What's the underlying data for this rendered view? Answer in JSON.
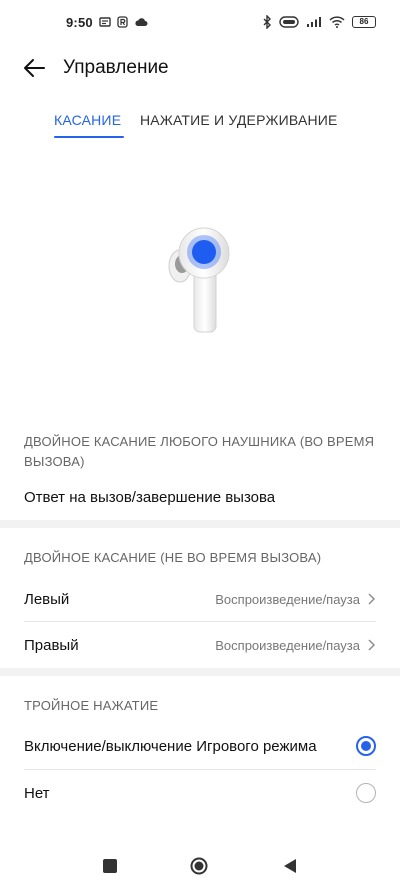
{
  "status_bar": {
    "time": "9:50",
    "battery": "86",
    "icons": [
      "message-icon",
      "r-icon",
      "cloud-icon",
      "bluetooth-icon",
      "earbuds-case-icon",
      "signal-icon",
      "wifi-icon",
      "battery-icon"
    ]
  },
  "header": {
    "title": "Управление",
    "back_icon": "arrow-left-icon"
  },
  "tabs": [
    {
      "label": "КАСАНИЕ",
      "active": true
    },
    {
      "label": "НАЖАТИЕ И УДЕРЖИВАНИЕ",
      "active": false
    }
  ],
  "sections": {
    "call": {
      "header": "ДВОЙНОЕ КАСАНИЕ ЛЮБОГО НАУШНИКА (ВО ВРЕМЯ ВЫЗОВА)",
      "value": "Ответ на вызов/завершение вызова"
    },
    "no_call": {
      "header": "ДВОЙНОЕ КАСАНИЕ (НЕ ВО ВРЕМЯ ВЫЗОВА)",
      "left_label": "Левый",
      "left_value": "Воспроизведение/пауза",
      "right_label": "Правый",
      "right_value": "Воспроизведение/пауза"
    },
    "triple": {
      "header": "ТРОЙНОЕ НАЖАТИЕ",
      "options": [
        {
          "label": "Включение/выключение Игрового режима",
          "selected": true
        },
        {
          "label": "Нет",
          "selected": false
        }
      ]
    }
  },
  "colors": {
    "accent": "#2563eb",
    "separator_band": "#f2f2f2"
  }
}
